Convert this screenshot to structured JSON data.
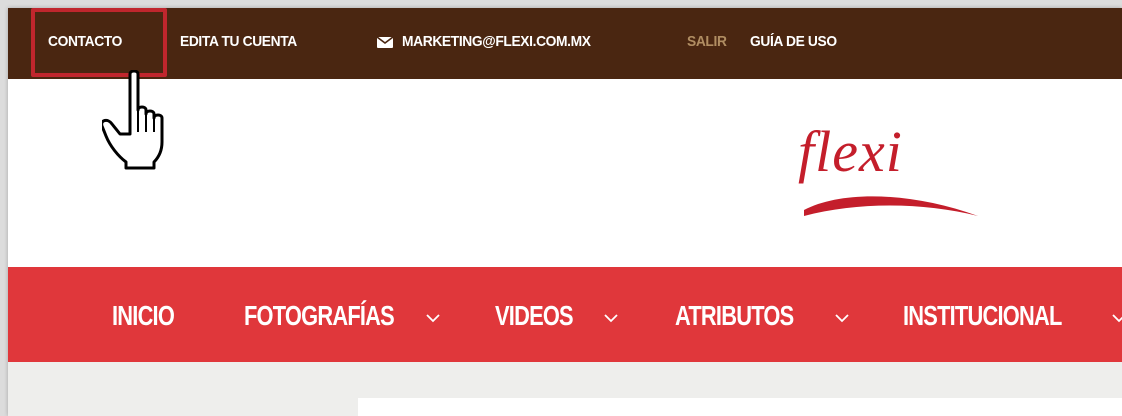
{
  "topbar": {
    "contact_label": "CONTACTO",
    "edit_account_label": "EDITA TU CUENTA",
    "email_icon": "envelope-icon",
    "email_label": "MARKETING@FLEXI.COM.MX",
    "logout_label": "SALIR",
    "guide_label": "GUÍA DE USO"
  },
  "header": {
    "logo_text": "flexi",
    "logo_color": "#c41e2b"
  },
  "nav": {
    "items": [
      {
        "label": "INICIO"
      },
      {
        "label": "FOTOGRAFÍAS"
      },
      {
        "label": "VIDEOS"
      },
      {
        "label": "ATRIBUTOS"
      },
      {
        "label": "INSTITUCIONAL"
      }
    ],
    "chevron_icon": "chevron-down-icon"
  },
  "colors": {
    "topbar_bg": "#4a2611",
    "nav_bg": "#e0373b",
    "highlight": "#c0262d",
    "logout_text": "#b08d62"
  },
  "annotation": {
    "cursor_icon": "hand-pointer-icon"
  }
}
